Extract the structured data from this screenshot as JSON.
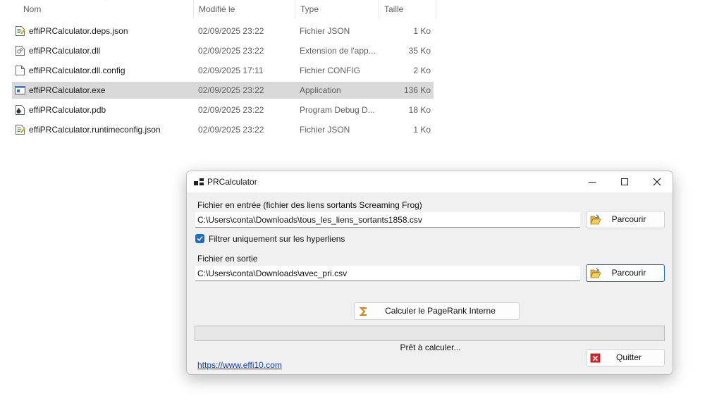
{
  "explorer": {
    "columns": {
      "name": "Nom",
      "date": "Modifié le",
      "type": "Type",
      "size": "Taille"
    },
    "files": [
      {
        "name": "effiPRCalculator.deps.json",
        "date": "02/09/2025 23:22",
        "type": "Fichier JSON",
        "size": "1 Ko",
        "icon": "json-file-icon"
      },
      {
        "name": "effiPRCalculator.dll",
        "date": "02/09/2025 23:22",
        "type": "Extension de l'app...",
        "size": "35 Ko",
        "icon": "dll-file-icon"
      },
      {
        "name": "effiPRCalculator.dll.config",
        "date": "02/09/2025 17:11",
        "type": "Fichier CONFIG",
        "size": "2 Ko",
        "icon": "config-file-icon"
      },
      {
        "name": "effiPRCalculator.exe",
        "date": "02/09/2025 23:22",
        "type": "Application",
        "size": "136 Ko",
        "icon": "exe-file-icon"
      },
      {
        "name": "effiPRCalculator.pdb",
        "date": "02/09/2025 23:22",
        "type": "Program Debug D...",
        "size": "18 Ko",
        "icon": "pdb-file-icon"
      },
      {
        "name": "effiPRCalculator.runtimeconfig.json",
        "date": "02/09/2025 23:22",
        "type": "Fichier JSON",
        "size": "1 Ko",
        "icon": "json-file-icon"
      }
    ]
  },
  "dialog": {
    "title": "PRCalculator",
    "input_label": "Fichier en entrée (fichier des liens sortants Screaming Frog)",
    "input_value": "C:\\Users\\conta\\Downloads\\tous_les_liens_sortants1858.csv",
    "browse_label": "Parcourir",
    "checkbox_label": "Filtrer uniquement sur les hyperliens",
    "checkbox_checked": true,
    "output_label": "Fichier en sortie",
    "output_value": "C:\\Users\\conta\\Downloads\\avec_pri.csv",
    "calculate_label": "Calculer le PageRank Interne",
    "progress": 0,
    "status": "Prêt à calculer...",
    "quit_label": "Quitter",
    "link": "https://www.effi10.com"
  }
}
